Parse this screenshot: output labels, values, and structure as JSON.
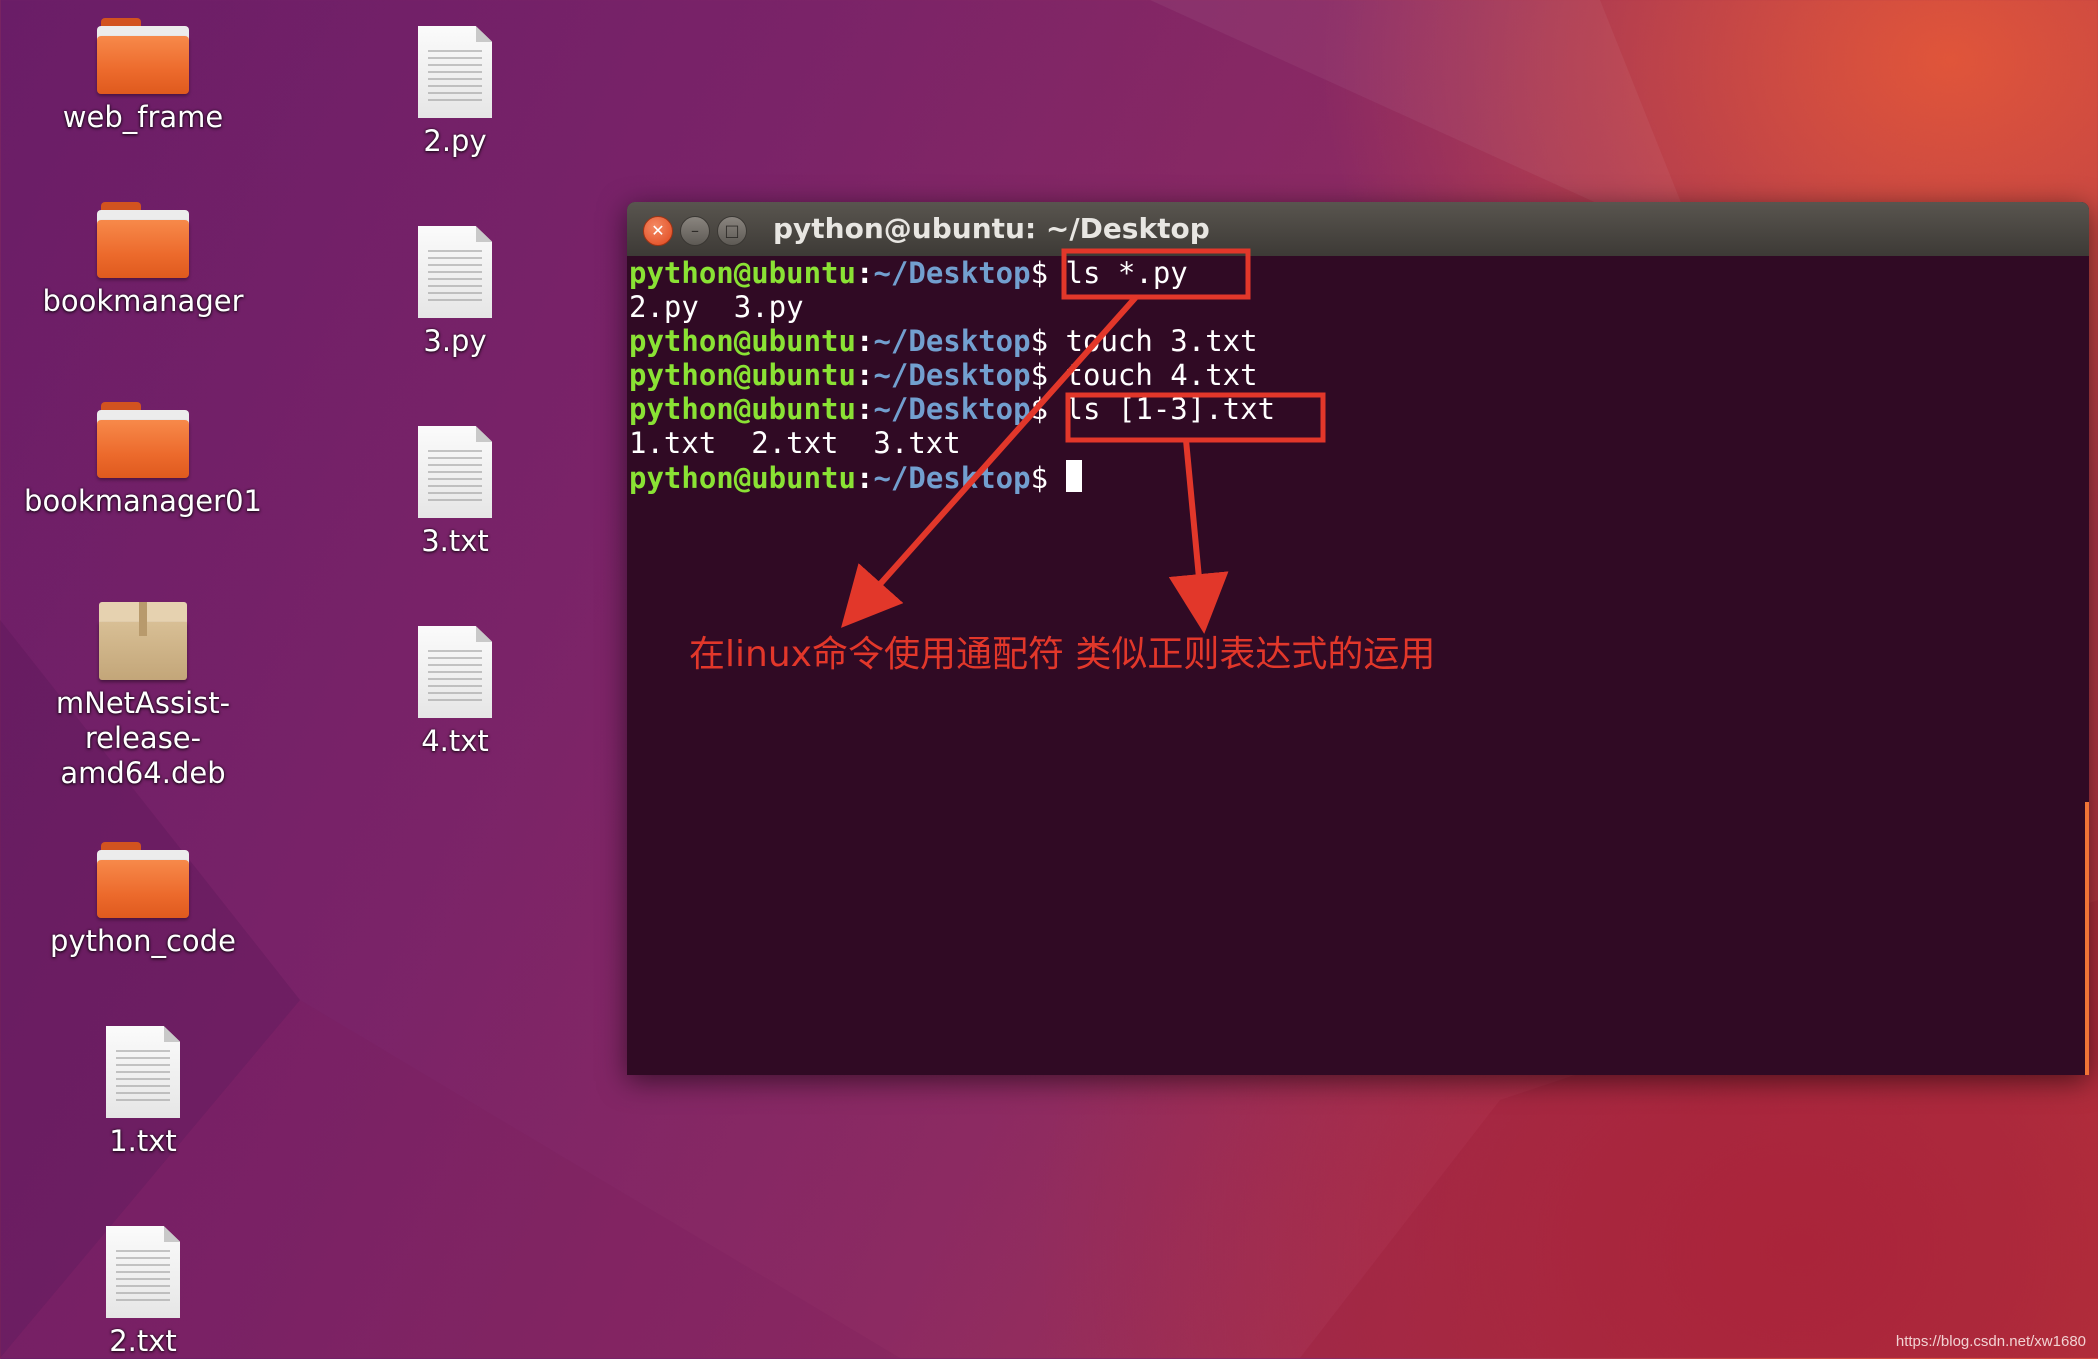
{
  "desktop": {
    "icons": [
      {
        "label": "web_frame",
        "type": "folder"
      },
      {
        "label": "bookmanager",
        "type": "folder"
      },
      {
        "label": "bookmanager01",
        "type": "folder"
      },
      {
        "label": "mNetAssist-release-amd64.deb",
        "type": "package"
      },
      {
        "label": "python_code",
        "type": "folder"
      },
      {
        "label": "1.txt",
        "type": "document"
      },
      {
        "label": "2.txt",
        "type": "document"
      },
      {
        "label": "2.py",
        "type": "document"
      },
      {
        "label": "3.py",
        "type": "document"
      },
      {
        "label": "3.txt",
        "type": "document"
      },
      {
        "label": "4.txt",
        "type": "document"
      }
    ]
  },
  "terminal": {
    "title": "python@ubuntu: ~/Desktop",
    "buttons": {
      "close": "close-icon",
      "minimize": "minimize-icon",
      "maximize": "maximize-icon"
    },
    "prompt": {
      "user": "python@ubuntu",
      "sep": ":",
      "path": "~/Desktop",
      "symbol": "$"
    },
    "lines": [
      {
        "kind": "cmd",
        "command": "ls *.py"
      },
      {
        "kind": "out",
        "text": "2.py  3.py"
      },
      {
        "kind": "cmd",
        "command": "touch 3.txt"
      },
      {
        "kind": "cmd",
        "command": "touch 4.txt"
      },
      {
        "kind": "cmd",
        "command": "ls [1-3].txt"
      },
      {
        "kind": "out",
        "text": "1.txt  2.txt  3.txt"
      },
      {
        "kind": "cmd",
        "command": ""
      }
    ]
  },
  "annotation": {
    "note": "在linux命令使用通配符 类似正则表达式的运用",
    "color": "#e2372a"
  },
  "watermark": "https://blog.csdn.net/xw1680",
  "colors": {
    "prompt_user": "#8ae234",
    "prompt_path": "#729fcf",
    "terminal_bg": "#300a24",
    "close_button": "#e0461d"
  }
}
